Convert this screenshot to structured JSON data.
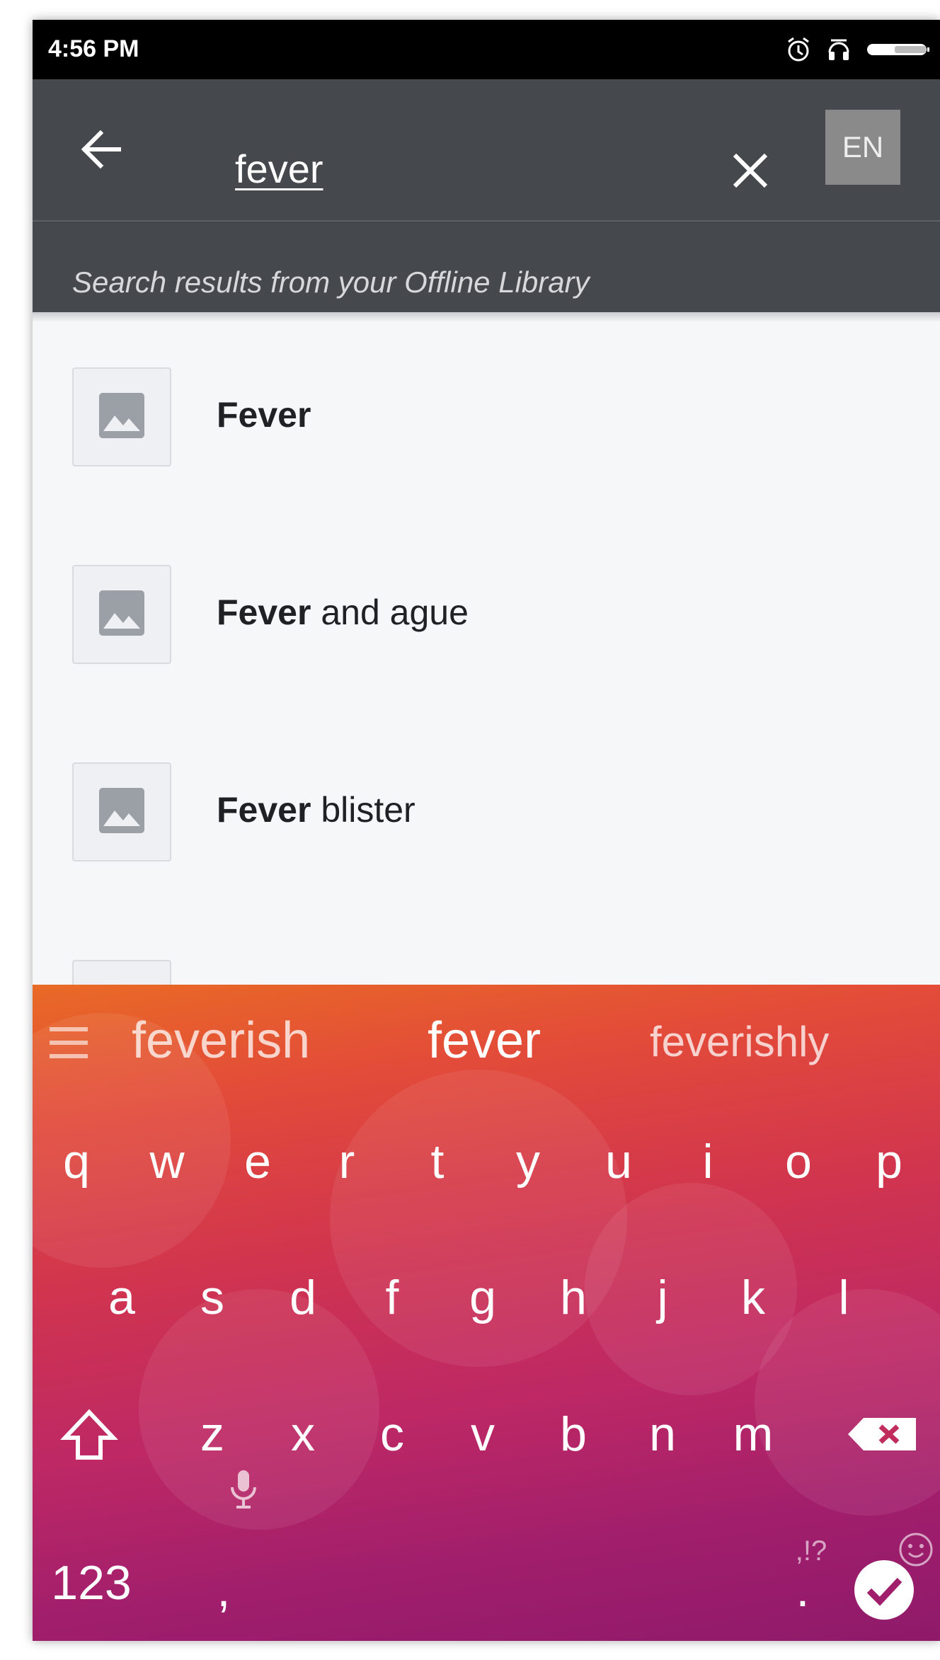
{
  "status_bar": {
    "time": "4:56 PM",
    "icons": [
      "alarm-icon",
      "headset-icon",
      "battery-icon"
    ]
  },
  "search": {
    "query": "fever",
    "language": "EN",
    "subheader": "Search results from your Offline Library"
  },
  "results": [
    {
      "bold": "Fever",
      "rest": ""
    },
    {
      "bold": "Fever",
      "rest": " and ague"
    },
    {
      "bold": "Fever",
      "rest": " blister"
    },
    {
      "bold": "",
      "rest": ""
    }
  ],
  "keyboard": {
    "suggestions": [
      "feverish",
      "fever",
      "feverishly"
    ],
    "rows": [
      [
        "q",
        "w",
        "e",
        "r",
        "t",
        "y",
        "u",
        "i",
        "o",
        "p"
      ],
      [
        "a",
        "s",
        "d",
        "f",
        "g",
        "h",
        "j",
        "k",
        "l"
      ],
      [
        "z",
        "x",
        "c",
        "v",
        "b",
        "n",
        "m"
      ]
    ],
    "numbers_key": "123",
    "comma_key": ",",
    "period_key": ".",
    "punct_hint": ",!?",
    "colors": {
      "top": "#e96a26",
      "bottom": "#8f1a6a"
    }
  }
}
